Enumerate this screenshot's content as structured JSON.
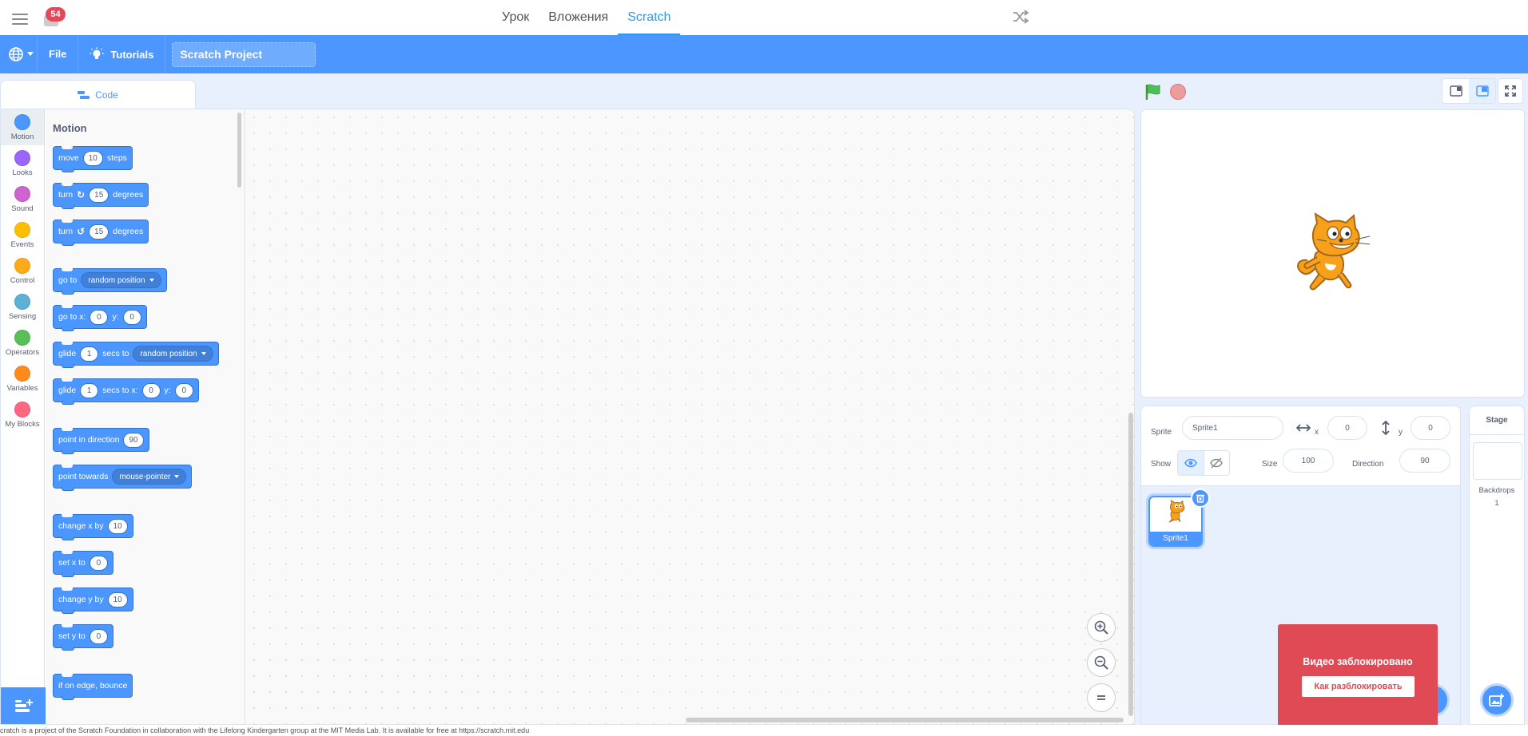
{
  "topbar": {
    "notification_count": "54",
    "tabs": [
      {
        "label": "Урок",
        "active": false
      },
      {
        "label": "Вложения",
        "active": false
      },
      {
        "label": "Scratch",
        "active": true
      }
    ]
  },
  "menubar": {
    "file_label": "File",
    "tutorials_label": "Tutorials",
    "project_title": "Scratch Project"
  },
  "editor": {
    "code_tab_label": "Code",
    "categories": [
      {
        "label": "Motion",
        "color": "#4c97ff"
      },
      {
        "label": "Looks",
        "color": "#9966ff"
      },
      {
        "label": "Sound",
        "color": "#cf63cf"
      },
      {
        "label": "Events",
        "color": "#ffbf00"
      },
      {
        "label": "Control",
        "color": "#ffab19"
      },
      {
        "label": "Sensing",
        "color": "#5cb1d6"
      },
      {
        "label": "Operators",
        "color": "#59c059"
      },
      {
        "label": "Variables",
        "color": "#ff8c1a"
      },
      {
        "label": "My Blocks",
        "color": "#ff6680"
      }
    ],
    "palette_title": "Motion",
    "blocks": {
      "move": {
        "a": "move",
        "v": "10",
        "b": "steps"
      },
      "turn_right": {
        "a": "turn",
        "v": "15",
        "b": "degrees"
      },
      "turn_left": {
        "a": "turn",
        "v": "15",
        "b": "degrees"
      },
      "go_to": {
        "a": "go to",
        "dd": "random position"
      },
      "go_to_xy": {
        "a": "go to x:",
        "x": "0",
        "b": "y:",
        "y": "0"
      },
      "glide_to": {
        "a": "glide",
        "v": "1",
        "b": "secs to",
        "dd": "random position"
      },
      "glide_xy": {
        "a": "glide",
        "v": "1",
        "b": "secs to x:",
        "x": "0",
        "c": "y:",
        "y": "0"
      },
      "point_dir": {
        "a": "point in direction",
        "v": "90"
      },
      "point_towards": {
        "a": "point towards",
        "dd": "mouse-pointer"
      },
      "change_x": {
        "a": "change x by",
        "v": "10"
      },
      "set_x": {
        "a": "set x to",
        "v": "0"
      },
      "change_y": {
        "a": "change y by",
        "v": "10"
      },
      "set_y": {
        "a": "set y to",
        "v": "0"
      },
      "bounce": {
        "a": "if on edge, bounce"
      }
    }
  },
  "sprite_info": {
    "sprite_label": "Sprite",
    "sprite_name": "Sprite1",
    "x_label": "x",
    "x_value": "0",
    "y_label": "y",
    "y_value": "0",
    "show_label": "Show",
    "size_label": "Size",
    "size_value": "100",
    "direction_label": "Direction",
    "direction_value": "90",
    "sprite_tile_name": "Sprite1"
  },
  "stage_selector": {
    "title": "Stage",
    "backdrops_label": "Backdrops",
    "backdrops_count": "1"
  },
  "blocked_video": {
    "title": "Видео заблокировано",
    "button_label": "Как разблокировать"
  },
  "footer": {
    "text": "cratch is a project of the Scratch Foundation in collaboration with the Lifelong Kindergarten group at the MIT Media Lab. It is available for free at https://scratch.mit.edu"
  },
  "colors": {
    "scratch_blue": "#4c97ff",
    "site_accent": "#2b9ae8",
    "blocked_red": "#e04a55"
  }
}
